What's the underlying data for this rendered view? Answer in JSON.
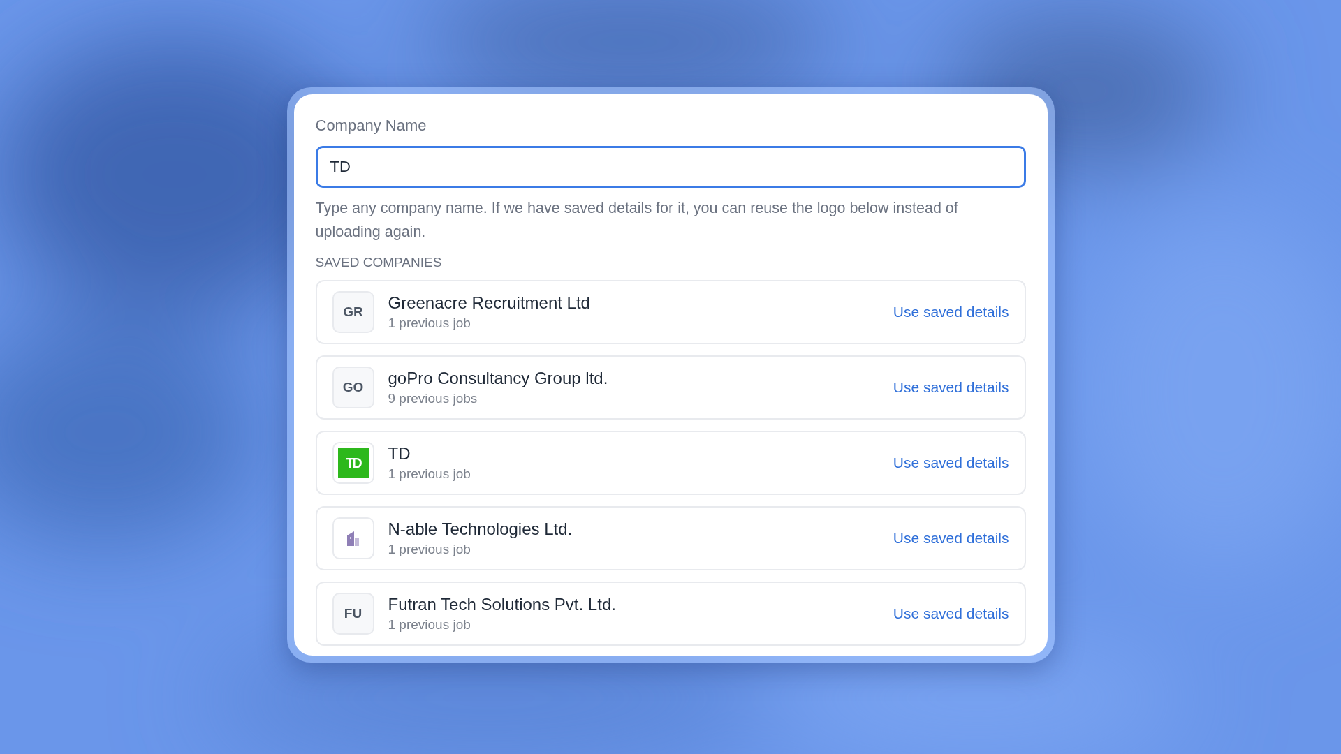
{
  "field": {
    "label": "Company Name",
    "value": "TD",
    "focused": true
  },
  "help_text": "Type any company name. If we have saved details for it, you can reuse the logo below instead of uploading again.",
  "section_title": "SAVED COMPANIES",
  "companies": [
    {
      "logo": {
        "kind": "initials",
        "text": "GR"
      },
      "name": "Greenacre Recruitment Ltd",
      "jobs": "1 previous job",
      "action": "Use saved details"
    },
    {
      "logo": {
        "kind": "initials",
        "text": "GO"
      },
      "name": "goPro Consultancy Group ltd.",
      "jobs": "9 previous jobs",
      "action": "Use saved details"
    },
    {
      "logo": {
        "kind": "brand",
        "text": "TD"
      },
      "name": "TD",
      "jobs": "1 previous job",
      "action": "Use saved details"
    },
    {
      "logo": {
        "kind": "icon"
      },
      "name": "N-able Technologies Ltd.",
      "jobs": "1 previous job",
      "action": "Use saved details"
    },
    {
      "logo": {
        "kind": "initials",
        "text": "FU"
      },
      "name": "Futran Tech Solutions Pvt. Ltd.",
      "jobs": "1 previous job",
      "action": "Use saved details"
    }
  ]
}
